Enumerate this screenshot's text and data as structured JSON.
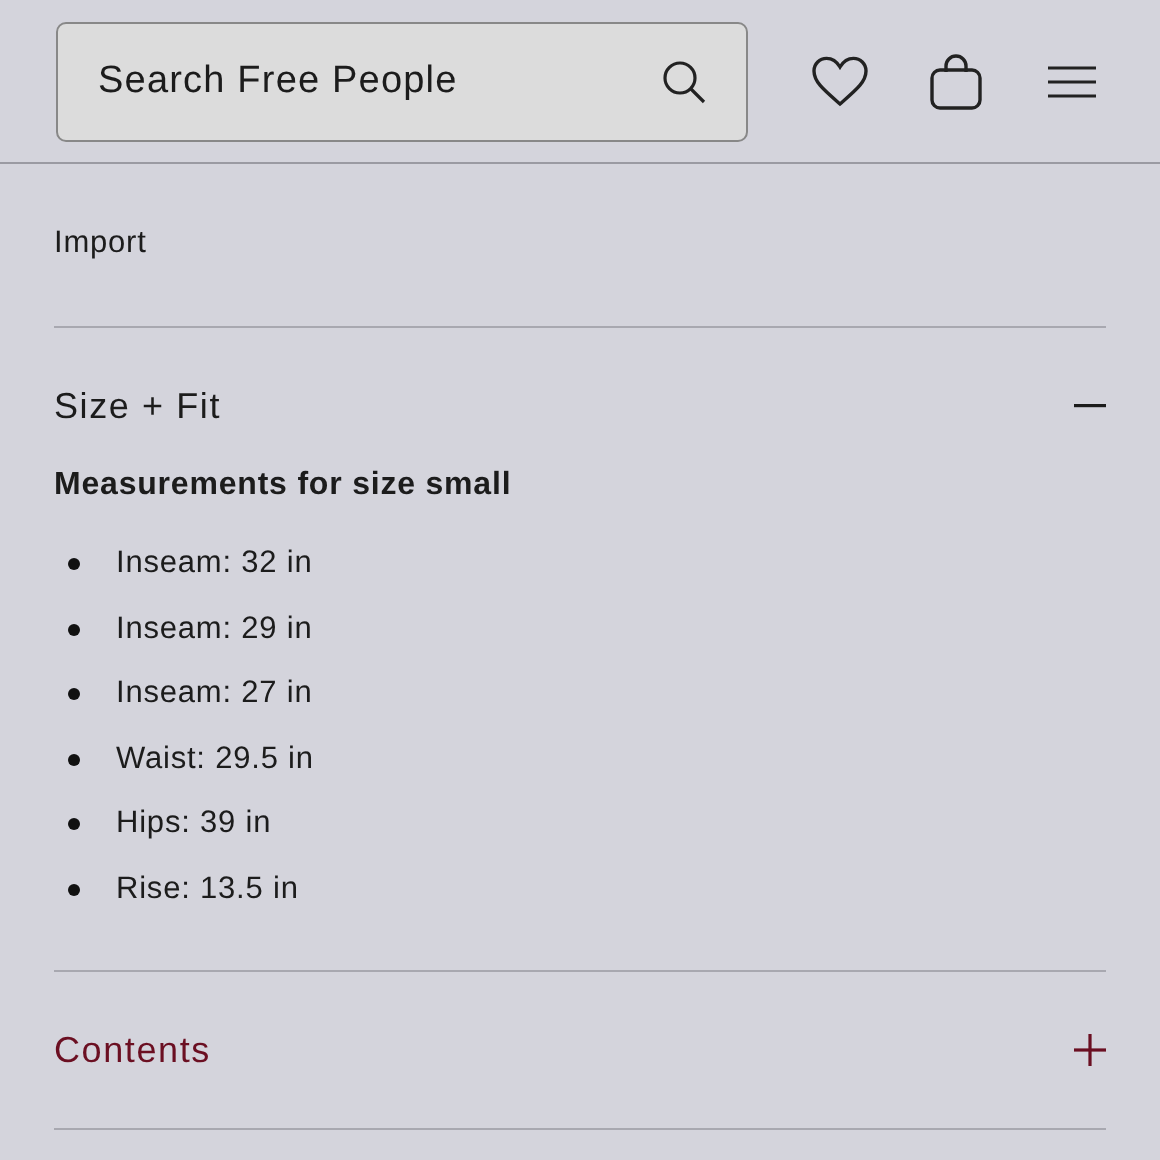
{
  "search": {
    "placeholder": "Search Free People"
  },
  "care_lines": [
    "Import"
  ],
  "sections": [
    {
      "title": "Size + Fit",
      "expanded": true,
      "highlighted": false,
      "heading": "Measurements for size small",
      "items": [
        "Inseam: 32 in",
        "Inseam: 29 in",
        "Inseam: 27 in",
        "Waist: 29.5 in",
        "Hips: 39 in",
        "Rise: 13.5 in"
      ]
    },
    {
      "title": "Contents",
      "expanded": false,
      "highlighted": true
    }
  ]
}
